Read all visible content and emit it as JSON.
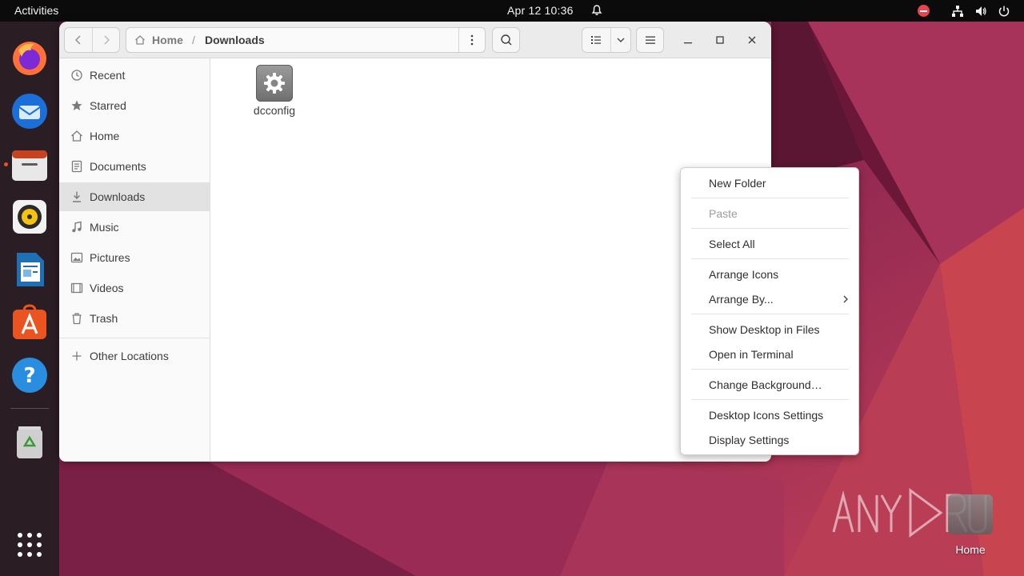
{
  "topbar": {
    "activities": "Activities",
    "clock": "Apr 12  10:36"
  },
  "dock": {
    "items": [
      "firefox-icon",
      "thunderbird-icon",
      "files-icon",
      "rhythmbox-icon",
      "libreoffice-writer-icon",
      "app-center-icon",
      "help-icon",
      "trash-icon",
      "show-apps-icon"
    ]
  },
  "window": {
    "path_home": "Home",
    "path_sep": "/",
    "path_current": "Downloads"
  },
  "sidebar": {
    "items": [
      {
        "label": "Recent",
        "icon": "clock-icon"
      },
      {
        "label": "Starred",
        "icon": "star-icon"
      },
      {
        "label": "Home",
        "icon": "home-icon"
      },
      {
        "label": "Documents",
        "icon": "document-icon"
      },
      {
        "label": "Downloads",
        "icon": "download-icon"
      },
      {
        "label": "Music",
        "icon": "music-icon"
      },
      {
        "label": "Pictures",
        "icon": "picture-icon"
      },
      {
        "label": "Videos",
        "icon": "video-icon"
      },
      {
        "label": "Trash",
        "icon": "trash-icon"
      }
    ],
    "other_locations": "Other Locations"
  },
  "content": {
    "files": [
      {
        "name": "dcconfig",
        "icon": "executable-gear-icon"
      }
    ]
  },
  "context_menu": {
    "new_folder": "New Folder",
    "paste": "Paste",
    "select_all": "Select All",
    "arrange_icons": "Arrange Icons",
    "arrange_by": "Arrange By...",
    "show_desktop": "Show Desktop in Files",
    "open_terminal": "Open in Terminal",
    "change_background": "Change Background…",
    "desktop_icons_settings": "Desktop Icons Settings",
    "display_settings": "Display Settings"
  },
  "desktop": {
    "home_label": "Home"
  },
  "colors": {
    "accent": "#e95420",
    "topbar": "#0b0b0b",
    "dock": "#2b1d24"
  }
}
